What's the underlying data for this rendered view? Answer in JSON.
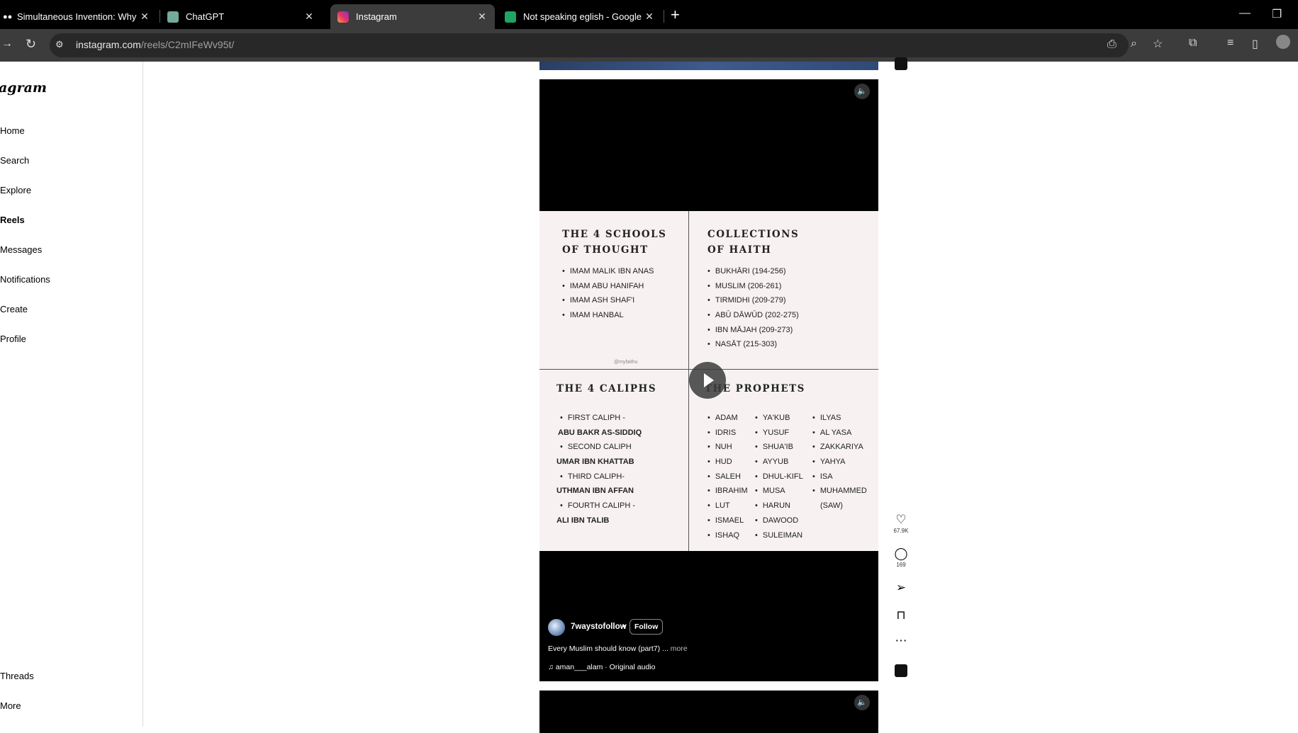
{
  "browser": {
    "tabs": [
      {
        "title": "Simultaneous Invention: Why Yo"
      },
      {
        "title": "ChatGPT"
      },
      {
        "title": "Instagram"
      },
      {
        "title": "Not speaking eglish - Google Sh"
      }
    ],
    "url_host": "instagram.com",
    "url_path": "/reels/C2mIFeWv95t/"
  },
  "sidebar": {
    "logo": "agram",
    "items": [
      {
        "label": "Home"
      },
      {
        "label": "Search"
      },
      {
        "label": "Explore"
      },
      {
        "label": "Reels"
      },
      {
        "label": "Messages"
      },
      {
        "label": "Notifications"
      },
      {
        "label": "Create"
      },
      {
        "label": "Profile"
      },
      {
        "label": "Threads"
      },
      {
        "label": "More"
      }
    ]
  },
  "reel": {
    "infographic": {
      "schools": {
        "title1": "THE 4 SCHOOLS",
        "title2": "OF THOUGHT",
        "items": [
          "IMAM MALIK IBN ANAS",
          "IMAM ABU HANIFAH",
          "IMAM ASH SHAF'I",
          "IMAM HANBAL"
        ]
      },
      "hadith": {
        "title1": "COLLECTIONS",
        "title2": "OF HAITH",
        "items": [
          "BUKHĀRI (194-256)",
          "MUSLIM (206-261)",
          "TIRMIDHI (209-279)",
          "ABŪ DĀWŪD (202-275)",
          "IBN MĀJAH (209-273)",
          "NASĀT (215-303)"
        ]
      },
      "watermark": "@myfaithu",
      "caliphs": {
        "title": "THE 4 CALIPHS",
        "items": [
          "FIRST CALIPH -",
          "ABU BAKR AS-SIDDIQ",
          "SECOND CALIPH",
          "UMAR IBN KHATTAB",
          "THIRD CALIPH-",
          "UTHMAN IBN AFFAN",
          "FOURTH CALIPH -",
          "ALI IBN TALIB"
        ]
      },
      "prophets": {
        "title": "THE PROPHETS",
        "col1": [
          "ADAM",
          "IDRIS",
          "NUH",
          "HUD",
          "SALEH",
          "IBRAHIM",
          "LUT",
          "ISMAEL",
          "ISHAQ"
        ],
        "col2": [
          "YA'KUB",
          "YUSUF",
          "SHUA'IB",
          "AYYUB",
          "DHUL-KIFL",
          "MUSA",
          "HARUN",
          "DAWOOD",
          "SULEIMAN"
        ],
        "col3": [
          "ILYAS",
          "AL YASA",
          "ZAKKARIYA",
          "YAHYA",
          "ISA",
          "MUHAMMED",
          "(SAW)"
        ]
      }
    },
    "username": "7waystofollow",
    "separator": "•",
    "follow_label": "Follow",
    "caption": "Every Muslim should know (part7) ...",
    "more_label": "more",
    "audio": "♫ aman___alam · Original audio"
  },
  "actions": {
    "likes": "67.9K",
    "comments": "169"
  },
  "icons": {
    "sound": "speaker-icon",
    "like": "heart-icon",
    "comment": "comment-icon",
    "share": "share-icon",
    "save": "bookmark-icon",
    "more": "more-icon"
  }
}
